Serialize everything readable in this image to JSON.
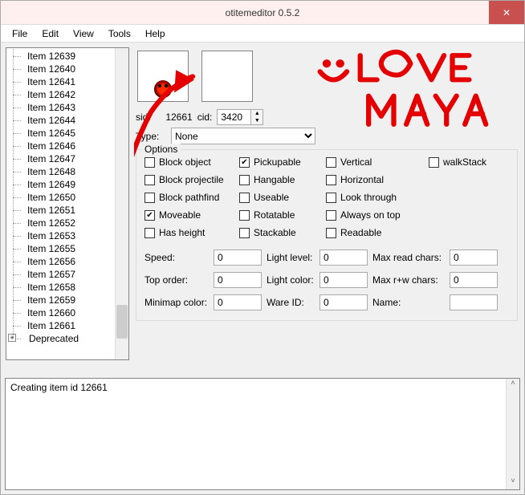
{
  "window": {
    "title": "otitemeditor 0.5.2"
  },
  "menu": {
    "file": "File",
    "edit": "Edit",
    "view": "View",
    "tools": "Tools",
    "help": "Help"
  },
  "tree": {
    "items": [
      "Item 12639",
      "Item 12640",
      "Item 12641",
      "Item 12642",
      "Item 12643",
      "Item 12644",
      "Item 12645",
      "Item 12646",
      "Item 12647",
      "Item 12648",
      "Item 12649",
      "Item 12650",
      "Item 12651",
      "Item 12652",
      "Item 12653",
      "Item 12655",
      "Item 12656",
      "Item 12657",
      "Item 12658",
      "Item 12659",
      "Item 12660",
      "Item 12661"
    ],
    "deprecated": "Deprecated"
  },
  "info": {
    "sid_label": "sid:",
    "sid_value": "12661",
    "cid_label": "cid:",
    "cid_value": "3420",
    "type_label": "Type:",
    "type_value": "None"
  },
  "options": {
    "legend": "Options",
    "block_object": "Block object",
    "pickupable": "Pickupable",
    "vertical": "Vertical",
    "walkstack": "walkStack",
    "block_projectile": "Block projectile",
    "hangable": "Hangable",
    "horizontal": "Horizontal",
    "block_pathfind": "Block pathfind",
    "useable": "Useable",
    "look_through": "Look through",
    "moveable": "Moveable",
    "rotatable": "Rotatable",
    "always_on_top": "Always on top",
    "has_height": "Has height",
    "stackable": "Stackable",
    "readable": "Readable"
  },
  "checked": {
    "pickupable": true,
    "moveable": true
  },
  "props": {
    "speed_label": "Speed:",
    "speed_value": "0",
    "light_level_label": "Light level:",
    "light_level_value": "0",
    "max_read_label": "Max read chars:",
    "max_read_value": "0",
    "top_order_label": "Top order:",
    "top_order_value": "0",
    "light_color_label": "Light color:",
    "light_color_value": "0",
    "max_rw_label": "Max r+w chars:",
    "max_rw_value": "0",
    "minimap_label": "Minimap color:",
    "minimap_value": "0",
    "ware_label": "Ware ID:",
    "ware_value": "0",
    "name_label": "Name:",
    "name_value": ""
  },
  "log": {
    "text": "Creating item id 12661"
  },
  "annotation": {
    "text": ":) LOVE MAYA"
  }
}
